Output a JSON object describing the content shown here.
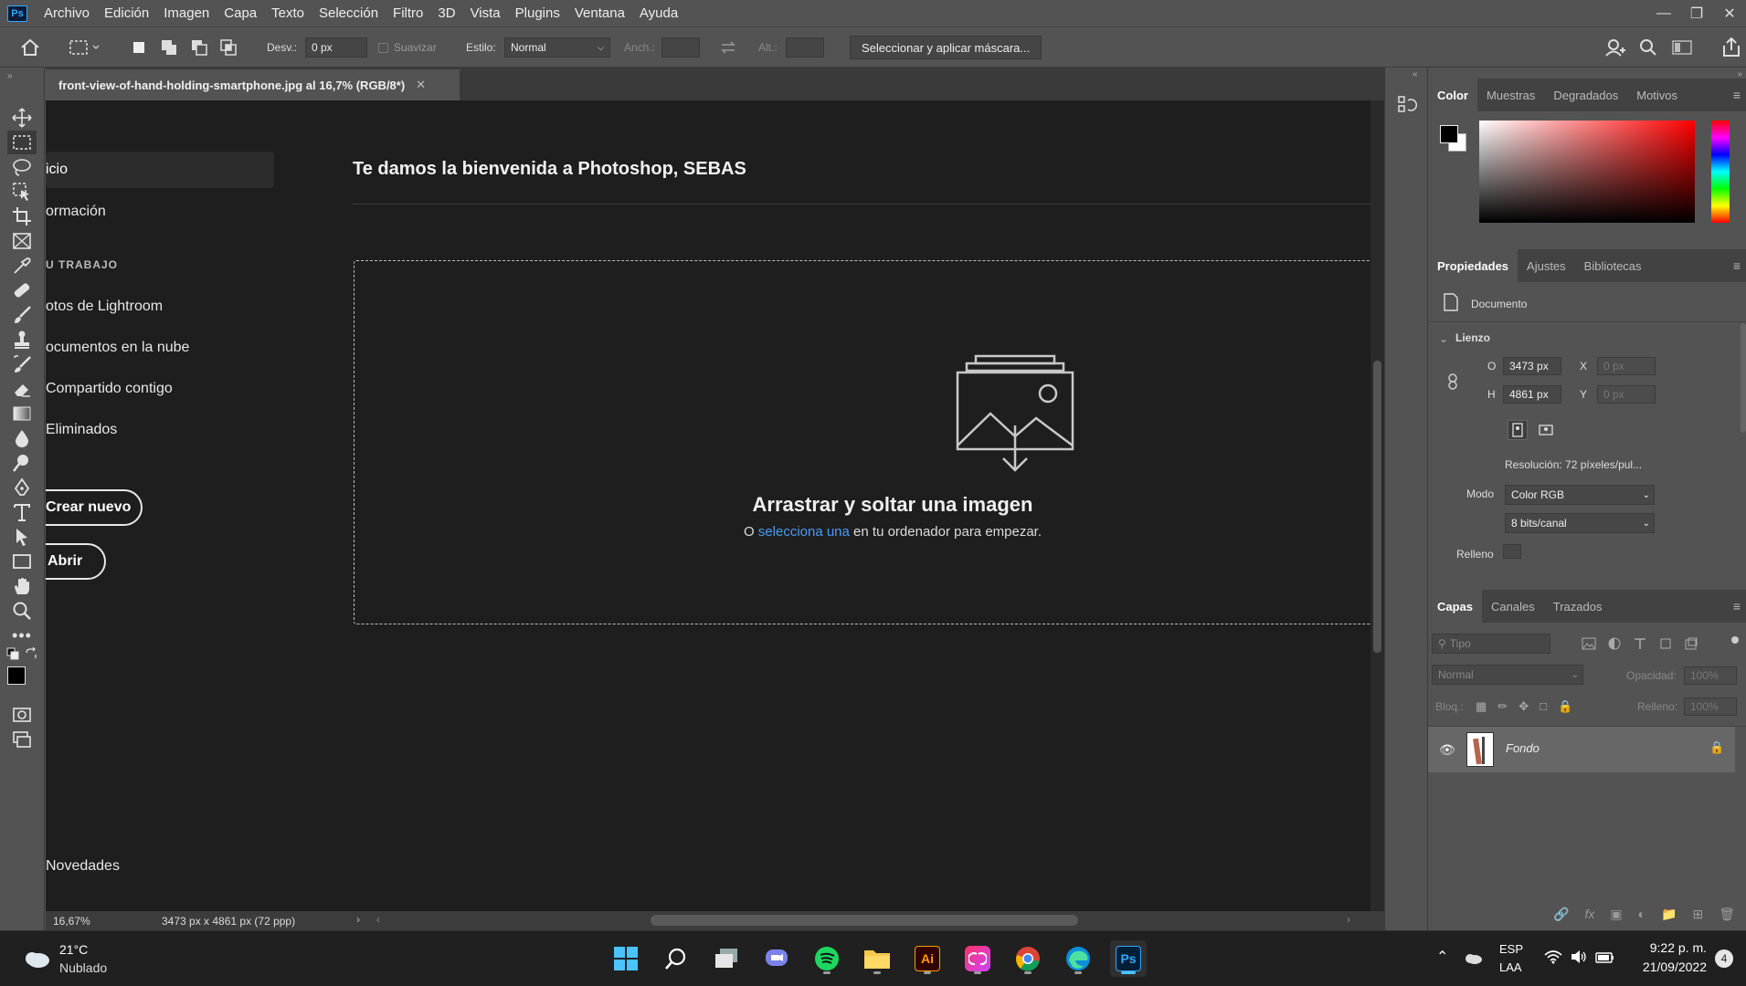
{
  "menu": [
    "Archivo",
    "Edición",
    "Imagen",
    "Capa",
    "Texto",
    "Selección",
    "Filtro",
    "3D",
    "Vista",
    "Plugins",
    "Ventana",
    "Ayuda"
  ],
  "app_logo": "Ps",
  "options": {
    "desv_label": "Desv.:",
    "desv_value": "0 px",
    "suavizar_label": "Suavizar",
    "estilo_label": "Estilo:",
    "estilo_value": "Normal",
    "anch_label": "Anch.:",
    "alt_label": "Alt.:",
    "mask_button": "Seleccionar y aplicar máscara..."
  },
  "document": {
    "tab_title": "front-view-of-hand-holding-smartphone.jpg al 16,7% (RGB/8*)",
    "zoom": "16,67%",
    "info": "3473 px x 4861 px (72 ppp)"
  },
  "home": {
    "nav": {
      "inicio": "icio",
      "formacion": "ormación",
      "section": "U TRABAJO",
      "lightroom": "otos de Lightroom",
      "nube": "ocumentos en la nube",
      "compartido": "Compartido contigo",
      "eliminados": "Eliminados",
      "crear": "Crear nuevo",
      "abrir": "Abrir",
      "novedades": "Novedades"
    },
    "welcome": "Te damos la bienvenida a Photoshop, SEBAS",
    "drop_title": "Arrastrar y soltar una imagen",
    "drop_prefix": "O",
    "drop_link": "selecciona una",
    "drop_suffix": "en tu ordenador para empezar."
  },
  "color_panel": {
    "tabs": [
      "Color",
      "Muestras",
      "Degradados",
      "Motivos"
    ]
  },
  "properties": {
    "tabs": [
      "Propiedades",
      "Ajustes",
      "Bibliotecas"
    ],
    "doc_label": "Documento",
    "section": "Lienzo",
    "w_label": "O",
    "w_value": "3473 px",
    "h_label": "H",
    "h_value": "4861 px",
    "x_label": "X",
    "x_value": "0 px",
    "y_label": "Y",
    "y_value": "0 px",
    "resolution": "Resolución: 72 píxeles/pul...",
    "mode_label": "Modo",
    "mode_value": "Color RGB",
    "bits_value": "8 bits/canal",
    "fill_label": "Relleno"
  },
  "layers": {
    "tabs": [
      "Capas",
      "Canales",
      "Trazados"
    ],
    "search_placeholder": "Tipo",
    "blend_mode": "Normal",
    "opacity_label": "Opacidad:",
    "opacity_value": "100%",
    "lock_label": "Bloq.:",
    "fill_label": "Relleno:",
    "fill_value": "100%",
    "layer_name": "Fondo"
  },
  "taskbar": {
    "weather_temp": "21°C",
    "weather_desc": "Nublado",
    "lang_top": "ESP",
    "lang_bottom": "LAA",
    "time": "9:22 p. m.",
    "date": "21/09/2022",
    "notif_count": "4"
  },
  "colors": {
    "accent_link": "#4b9cf5",
    "ps_blue": "#31a8ff",
    "canvas_bg": "#1e1e1e"
  }
}
